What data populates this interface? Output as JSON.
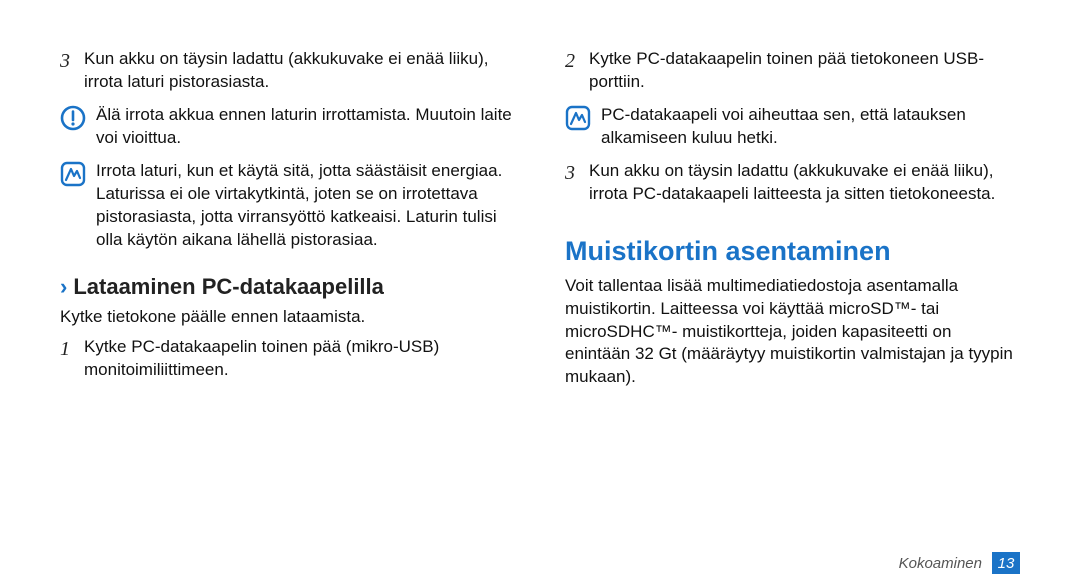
{
  "left": {
    "step3": "Kun akku on täysin ladattu (akkukuvake ei enää liiku), irrota laturi pistorasiasta.",
    "warn1": "Älä irrota akkua ennen laturin irrottamista. Muutoin laite voi vioittua.",
    "info1": "Irrota laturi, kun et käytä sitä, jotta säästäisit energiaa. Laturissa ei ole virtakytkintä, joten se on irrotettava pistorasiasta, jotta virransyöttö katkeaisi. Laturin tulisi olla käytön aikana lähellä pistorasiaa.",
    "h3": "Lataaminen PC-datakaapelilla",
    "intro": "Kytke tietokone päälle ennen lataamista.",
    "step1": "Kytke PC-datakaapelin toinen pää (mikro-USB) monitoimiliittimeen."
  },
  "right": {
    "step2": "Kytke PC-datakaapelin toinen pää tietokoneen USB-porttiin.",
    "info1": "PC-datakaapeli voi aiheuttaa sen, että latauksen alkamiseen kuluu hetki.",
    "step3": "Kun akku on täysin ladattu (akkukuvake ei enää liiku), irrota PC-datakaapeli laitteesta ja sitten tietokoneesta.",
    "h2": "Muistikortin asentaminen",
    "body": "Voit tallentaa lisää multimediatiedostoja asentamalla muistikortin. Laitteessa voi käyttää microSD™- tai microSDHC™- muistikortteja, joiden kapasiteetti on enintään 32 Gt (määräytyy muistikortin valmistajan ja tyypin mukaan)."
  },
  "nums": {
    "n1": "1",
    "n2": "2",
    "n3a": "3",
    "n3b": "3"
  },
  "footer": {
    "section": "Kokoaminen",
    "page": "13"
  },
  "chevron": "›"
}
